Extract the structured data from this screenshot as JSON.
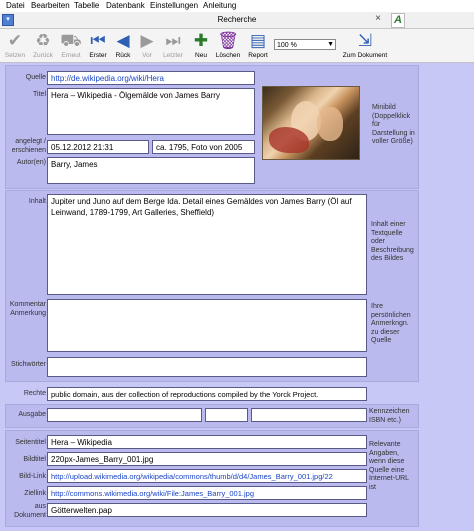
{
  "menu": [
    "Datei",
    "Bearbeiten",
    "Tabelle",
    "Datenbank",
    "Einstellungen",
    "Anleitung"
  ],
  "window": {
    "title": "Recherche",
    "close": "×",
    "font_icon": "A"
  },
  "toolbar": {
    "buttons": [
      {
        "label": "Setzen",
        "icon": "✔",
        "enabled": false
      },
      {
        "label": "Zurück",
        "icon": "♻",
        "enabled": false
      },
      {
        "label": "Erneut",
        "icon": "⛟",
        "enabled": false
      },
      {
        "label": "Erster",
        "icon": "⏮",
        "enabled": true
      },
      {
        "label": "Rück",
        "icon": "◀",
        "enabled": true
      },
      {
        "label": "Vor",
        "icon": "▶",
        "enabled": false
      },
      {
        "label": "Letzter",
        "icon": "⏭",
        "enabled": false
      },
      {
        "label": "Neu",
        "icon": "✚",
        "enabled": true
      },
      {
        "label": "Löschen",
        "icon": "🗑",
        "enabled": true
      },
      {
        "label": "Report",
        "icon": "▤",
        "enabled": true
      }
    ],
    "zoom": "100 %",
    "to_document": "Zum Dokument"
  },
  "form": {
    "quelle_label": "Quelle",
    "quelle": "http://de.wikipedia.org/wiki/Hera",
    "titel_label": "Titel",
    "titel": "Hera – Wikipedia - Ölgemälde von James Barry",
    "angelegt_label_1": "angelegt /",
    "angelegt_label_2": "erschienen",
    "angelegt": "05.12.2012 21:31",
    "erschienen": "ca. 1795, Foto von 2005",
    "autor_label": "Autor(en)",
    "autor": "Barry, James",
    "minibild_note": "Minibild (Doppelklick für Darstellung in voller Größe)",
    "inhalt_label": "Inhalt",
    "inhalt": "Jupiter und Juno auf dem Berge Ida. Detail eines Gemäldes von James Barry (Öl auf Leinwand, 1789-1799, Art Galleries, Sheffield)",
    "inhalt_note": "Inhalt einer Textquelle oder Beschreibung des Bildes",
    "kommentar_label_1": "Kommentar",
    "kommentar_label_2": "Anmerkung",
    "kommentar": "",
    "kommentar_note": "Ihre persönlichen Anmerkngn. zu dieser Quelle",
    "stichwoerter_label": "Stichwörter",
    "stichwoerter": "",
    "rechte_label": "Rechte",
    "rechte": "public domain, aus der collection of reproductions compiled by the Yorck Project.",
    "ausgabe_label": "Ausgabe",
    "ausgabe_1": "",
    "ausgabe_2": "",
    "ausgabe_3": "",
    "ausgabe_note": "Kennzeichen ISBN etc.)",
    "seitentitel_label": "Seitentitel",
    "seitentitel": "Hera – Wikipedia",
    "bildtitel_label": "Bildtitel",
    "bildtitel": "220px-James_Barry_001.jpg",
    "bildlink_label": "Bild-Link",
    "bildlink": "http://upload.wikimedia.org/wikipedia/commons/thumb/d/d4/James_Barry_001.jpg/22",
    "ziellink_label": "Ziellink",
    "ziellink": "http://commons.wikimedia.org/wiki/File:James_Barry_001.jpg",
    "aus_dokument_label_1": "aus",
    "aus_dokument_label_2": "Dokument",
    "aus_dokument": "Götterwelten.pap",
    "web_note": "Relevante Angaben, wenn diese Quelle eine Internet-URL ist"
  }
}
